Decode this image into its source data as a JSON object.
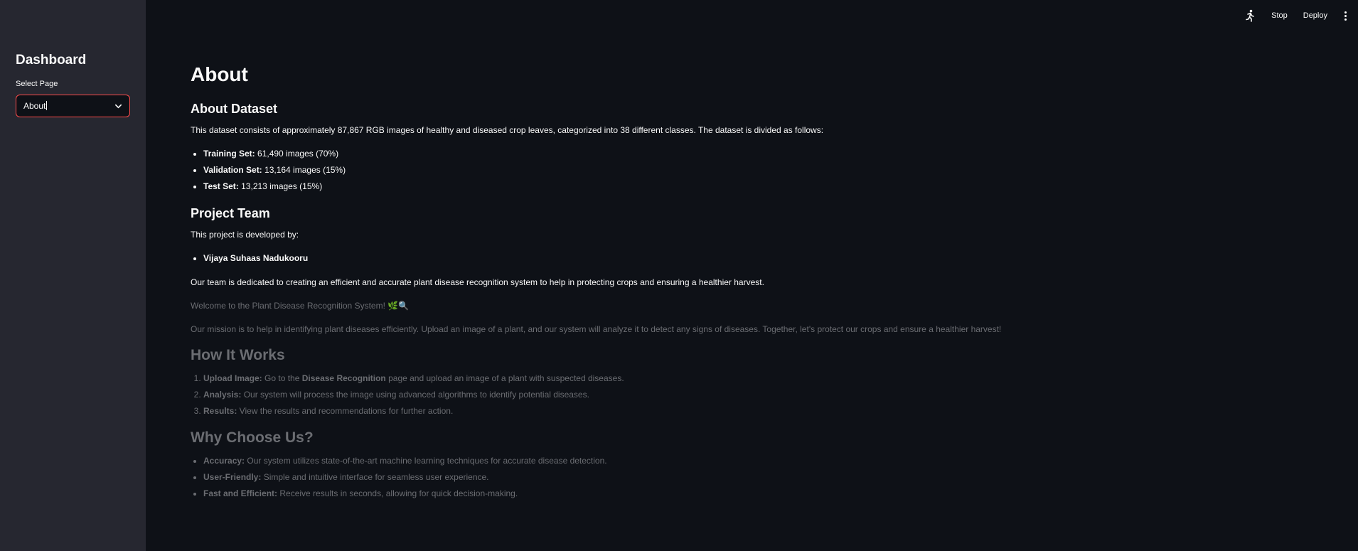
{
  "header": {
    "running_icon": "running-person-icon",
    "stop_label": "Stop",
    "deploy_label": "Deploy",
    "menu_icon": "kebab-menu-icon"
  },
  "sidebar": {
    "title": "Dashboard",
    "select_label": "Select Page",
    "select_value": "About"
  },
  "content": {
    "title": "About",
    "dataset": {
      "heading": "About Dataset",
      "intro": "This dataset consists of approximately 87,867 RGB images of healthy and diseased crop leaves, categorized into 38 different classes. The dataset is divided as follows:",
      "items": [
        {
          "label": "Training Set:",
          "text": " 61,490 images (70%)"
        },
        {
          "label": "Validation Set:",
          "text": " 13,164 images (15%)"
        },
        {
          "label": "Test Set:",
          "text": " 13,213 images (15%)"
        }
      ]
    },
    "team": {
      "heading": "Project Team",
      "intro": "This project is developed by:",
      "members": [
        "Vijaya Suhaas Nadukooru"
      ],
      "closing": "Our team is dedicated to creating an efficient and accurate plant disease recognition system to help in protecting crops and ensuring a healthier harvest."
    },
    "home_faded": {
      "welcome": "Welcome to the Plant Disease Recognition System! 🌿🔍",
      "mission": "Our mission is to help in identifying plant diseases efficiently. Upload an image of a plant, and our system will analyze it to detect any signs of diseases. Together, let's protect our crops and ensure a healthier harvest!",
      "how_heading": "How It Works",
      "steps": [
        {
          "label": "Upload Image:",
          "pre": " Go to the ",
          "bold": "Disease Recognition",
          "post": " page and upload an image of a plant with suspected diseases."
        },
        {
          "label": "Analysis:",
          "text": " Our system will process the image using advanced algorithms to identify potential diseases."
        },
        {
          "label": "Results:",
          "text": " View the results and recommendations for further action."
        }
      ],
      "why_heading": "Why Choose Us?",
      "reasons": [
        {
          "label": "Accuracy:",
          "text": " Our system utilizes state-of-the-art machine learning techniques for accurate disease detection."
        },
        {
          "label": "User-Friendly:",
          "text": " Simple and intuitive interface for seamless user experience."
        },
        {
          "label": "Fast and Efficient:",
          "text": " Receive results in seconds, allowing for quick decision-making."
        }
      ]
    }
  },
  "colors": {
    "background": "#0e1117",
    "sidebar": "#262730",
    "accent": "#ff4b4b",
    "faded_text": "#6b6d72"
  }
}
